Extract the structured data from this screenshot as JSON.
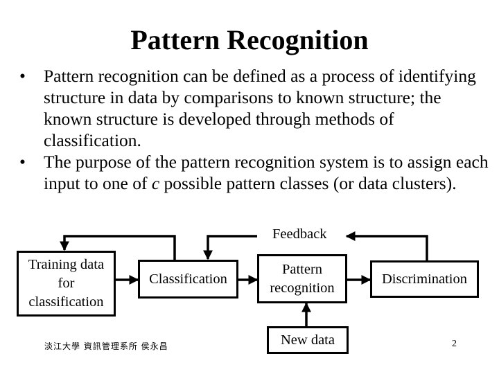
{
  "slide": {
    "title": "Pattern Recognition",
    "bullets": [
      {
        "marker": "•",
        "text": "Pattern recognition can be defined as a process of identifying structure in data by comparisons to known structure; the known structure is developed through methods of classification."
      },
      {
        "marker": "•",
        "text_before": "The purpose of the pattern recognition system is to assign each input to one of ",
        "italic": "c",
        "text_after": " possible pattern classes (or data clusters)."
      }
    ],
    "diagram": {
      "nodes": {
        "training": "Training data for classification",
        "training_lines": [
          "Training data",
          "for",
          "classification"
        ],
        "classification": "Classification",
        "pattern_recognition_lines": [
          "Pattern",
          "recognition"
        ],
        "discrimination": "Discrimination",
        "new_data": "New data"
      },
      "feedback_label": "Feedback",
      "edges": [
        {
          "from": "Training data for classification",
          "to": "Classification"
        },
        {
          "from": "Classification",
          "to": "Pattern recognition"
        },
        {
          "from": "Pattern recognition",
          "to": "Discrimination"
        },
        {
          "from": "New data",
          "to": "Pattern recognition"
        },
        {
          "from": "Classification",
          "to": "Training data for classification"
        },
        {
          "from": "Discrimination",
          "to": "Feedback"
        },
        {
          "from": "Feedback",
          "to": "Classification"
        }
      ]
    },
    "footer": {
      "author": "淡江大學 資訊管理系所 侯永昌",
      "page_number": "2"
    }
  }
}
